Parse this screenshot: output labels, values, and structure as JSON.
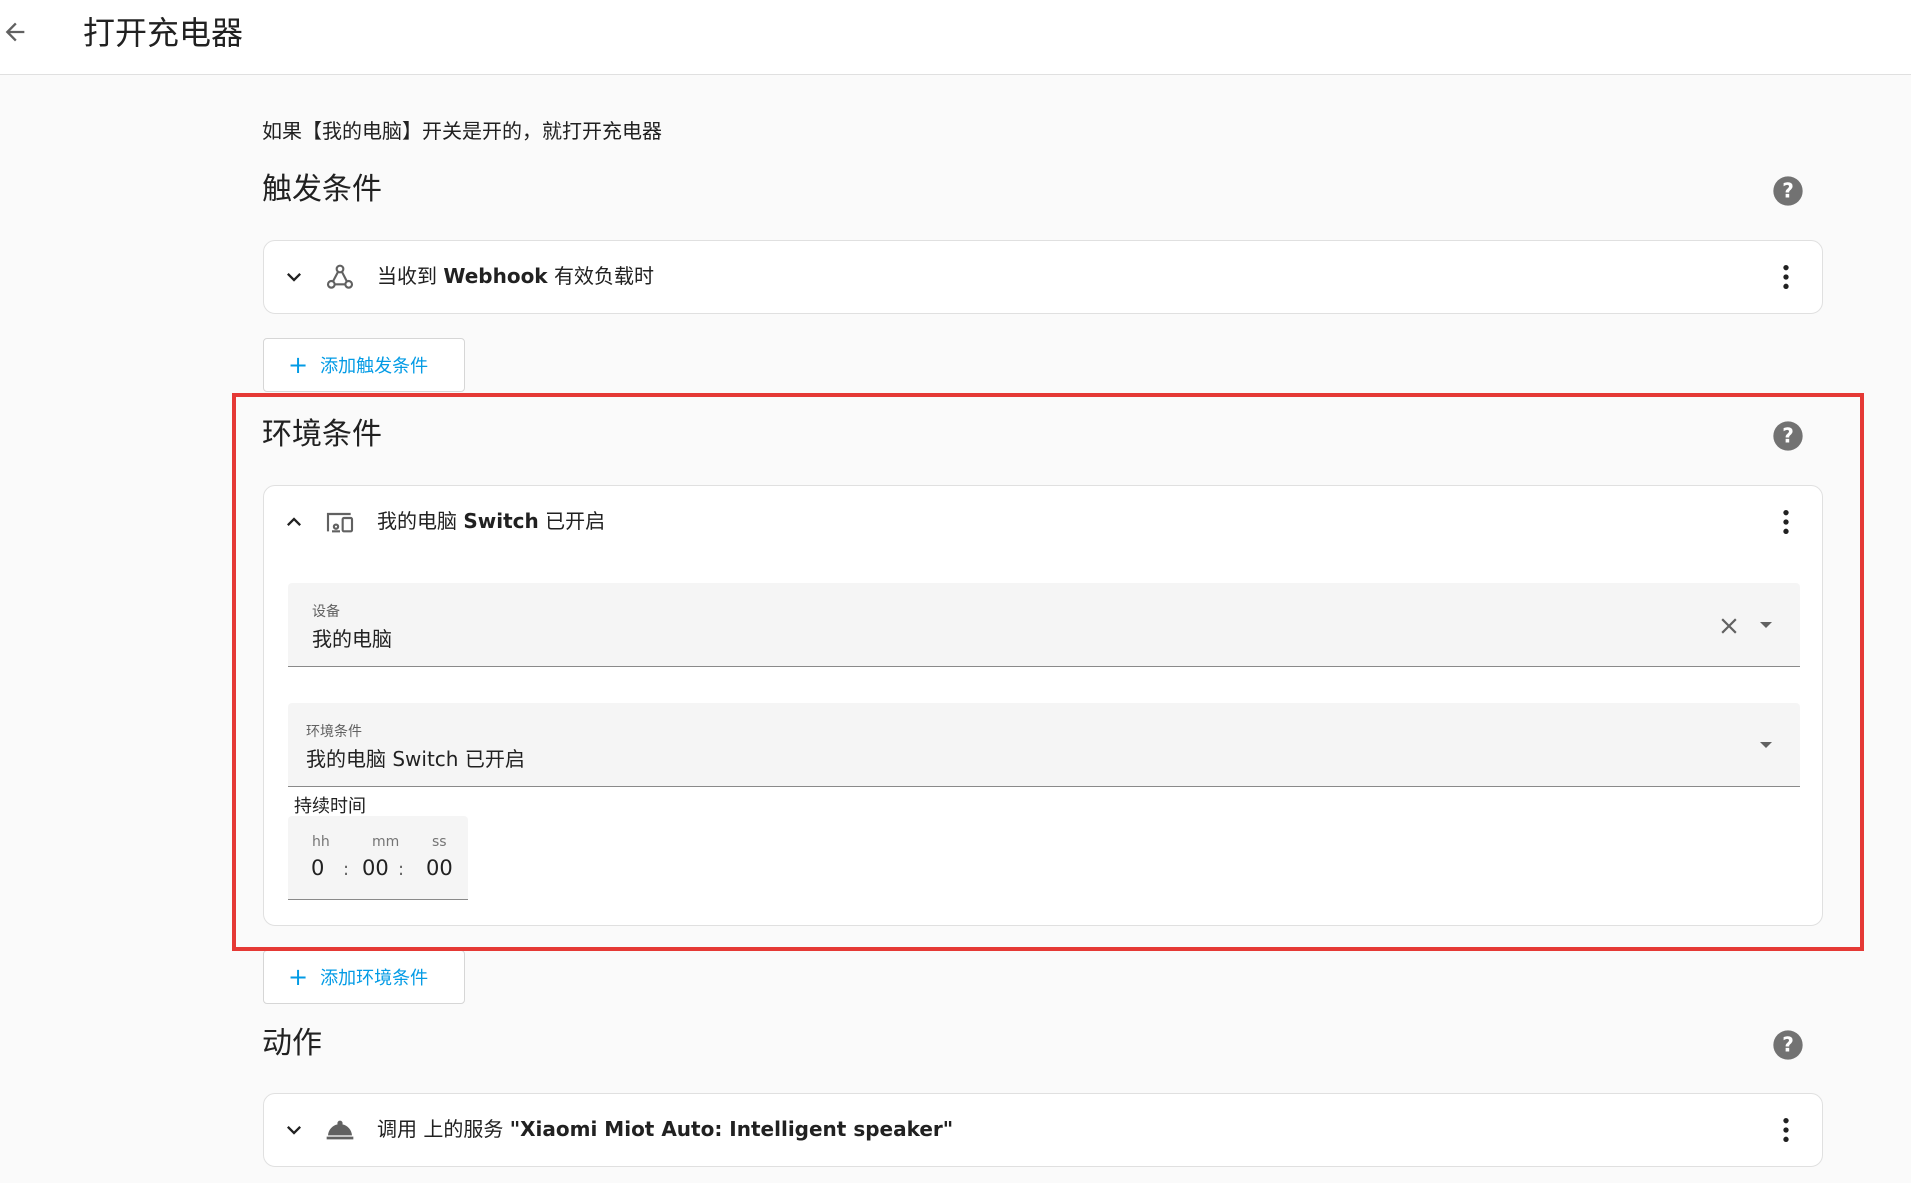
{
  "header": {
    "title": "打开充电器"
  },
  "description": "如果【我的电脑】开关是开的，就打开充电器",
  "triggers": {
    "title": "触发条件",
    "item": {
      "prefix": "当收到 ",
      "bold": "Webhook",
      "suffix": " 有效负载时"
    },
    "add_label": "添加触发条件"
  },
  "conditions": {
    "title": "环境条件",
    "item": {
      "prefix": "我的电脑 ",
      "bold": "Switch",
      "suffix": " 已开启"
    },
    "device_field": {
      "label": "设备",
      "value": "我的电脑"
    },
    "condition_field": {
      "label": "环境条件",
      "value": "我的电脑 Switch 已开启"
    },
    "duration": {
      "label": "持续时间",
      "hh_label": "hh",
      "hh": "0",
      "mm_label": "mm",
      "mm": "00",
      "ss_label": "ss",
      "ss": "00",
      "sep": ":"
    },
    "add_label": "添加环境条件"
  },
  "actions": {
    "title": "动作",
    "item": {
      "prefix": "调用 上的服务 ",
      "bold": "\"Xiaomi Miot Auto: Intelligent speaker\"",
      "suffix": ""
    }
  },
  "colors": {
    "accent": "#039be5",
    "highlight": "#e53935"
  }
}
